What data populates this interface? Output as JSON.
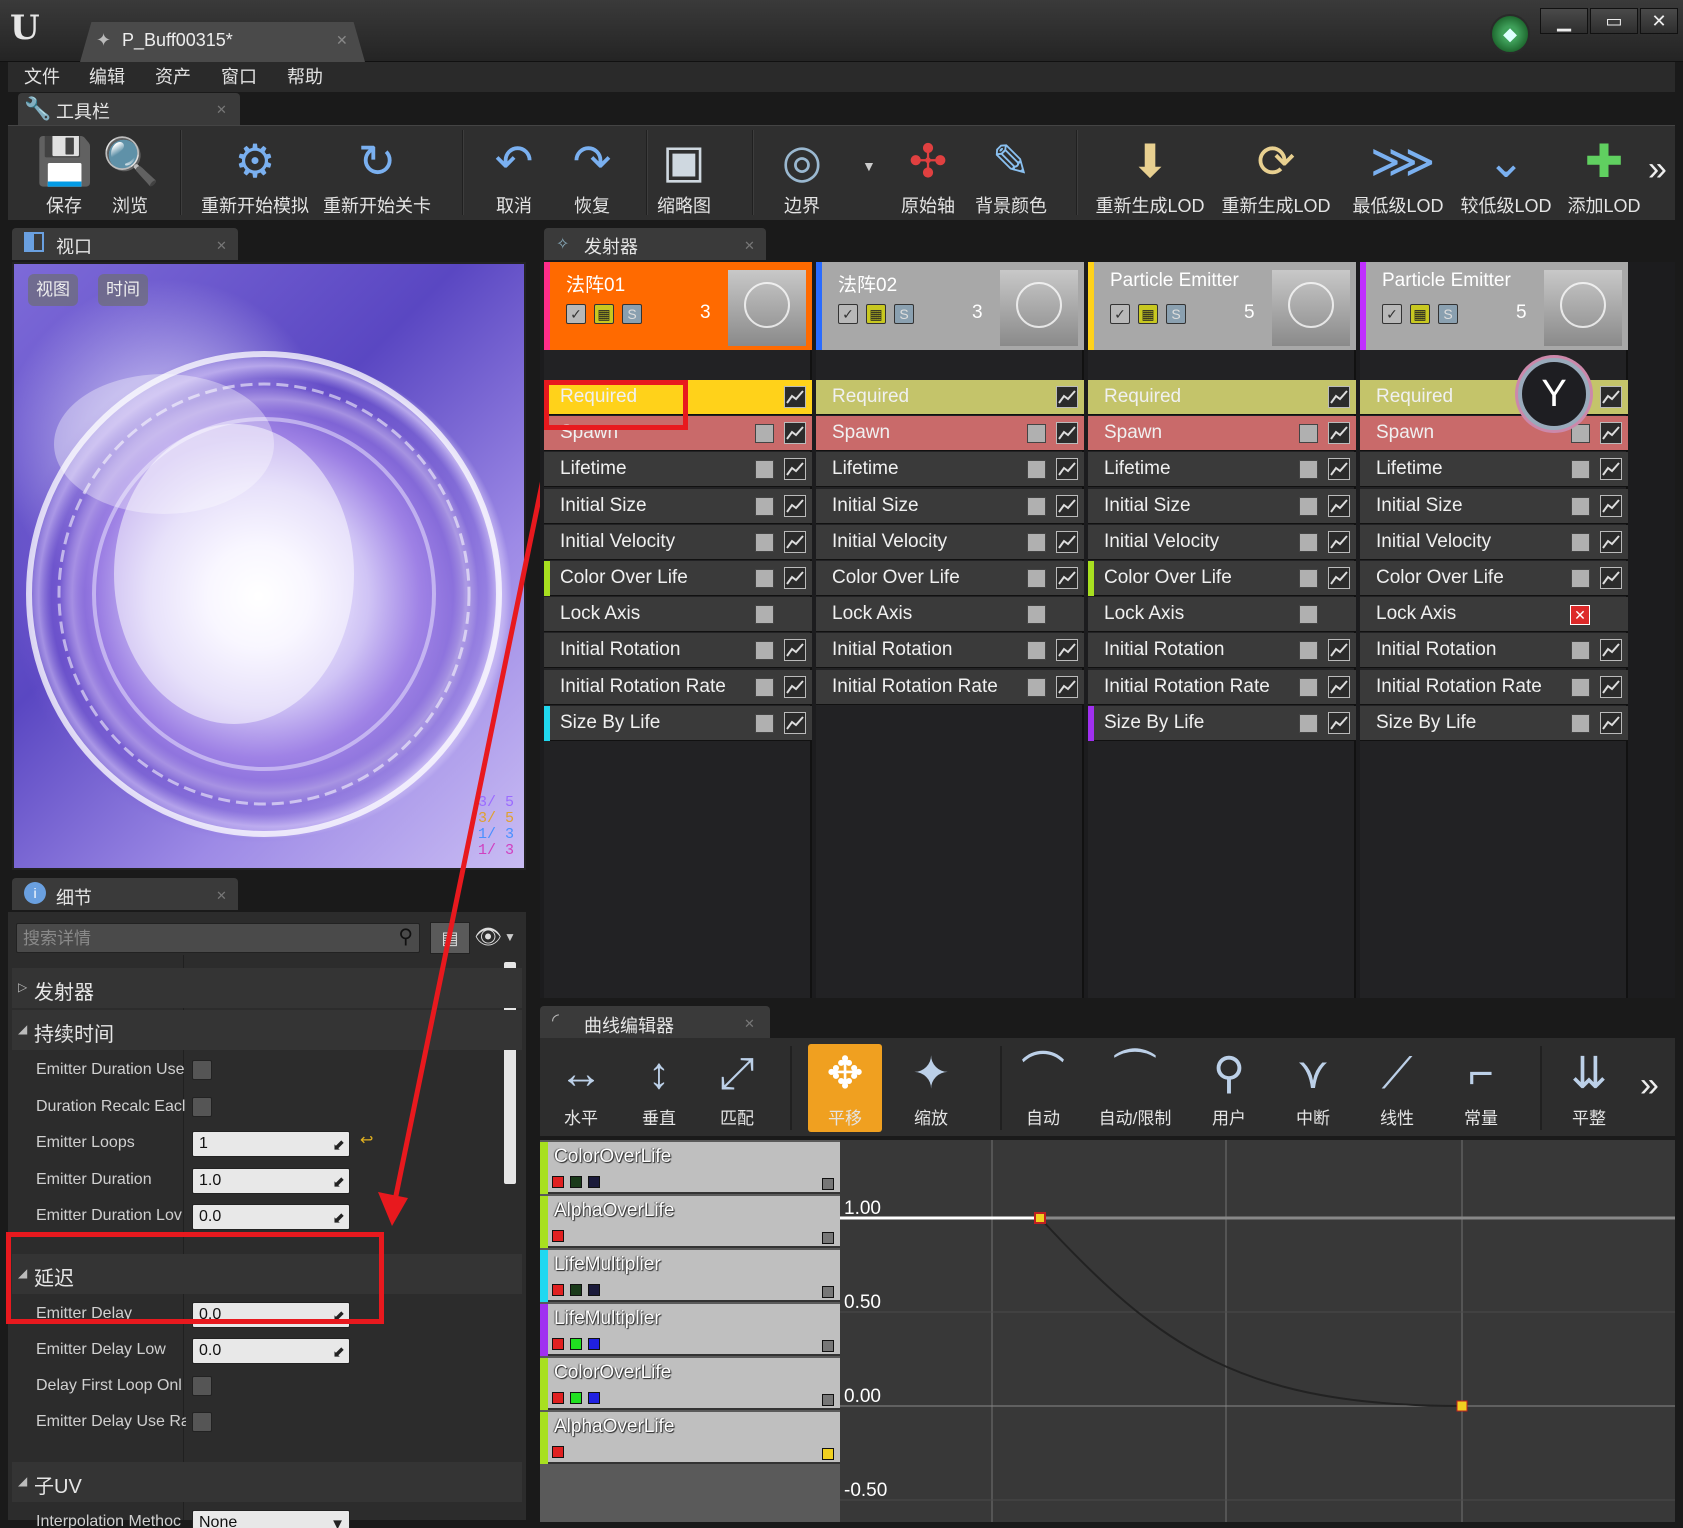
{
  "window": {
    "doc_tab": "P_Buff00315*",
    "minimize": "▁",
    "maximize": "▭",
    "close": "✕"
  },
  "menu": [
    "文件",
    "编辑",
    "资产",
    "窗口",
    "帮助"
  ],
  "toolbar": {
    "tab": "工具栏",
    "items": [
      {
        "label": "保存",
        "icon": "save-icon"
      },
      {
        "label": "浏览",
        "icon": "browse-icon"
      },
      {
        "label": "重新开始模拟",
        "icon": "restart-sim-icon"
      },
      {
        "label": "重新开始关卡",
        "icon": "restart-level-icon"
      },
      {
        "label": "取消",
        "icon": "undo-icon"
      },
      {
        "label": "恢复",
        "icon": "redo-icon"
      },
      {
        "label": "缩略图",
        "icon": "thumbnail-icon"
      },
      {
        "label": "边界",
        "icon": "bounds-icon"
      },
      {
        "label": "原始轴",
        "icon": "origin-axis-icon"
      },
      {
        "label": "背景颜色",
        "icon": "background-color-icon"
      },
      {
        "label": "重新生成LOD",
        "icon": "regen-lod-icon"
      },
      {
        "label": "重新生成LOD",
        "icon": "regen-lod-alt-icon"
      },
      {
        "label": "最低级LOD",
        "icon": "lowest-lod-icon"
      },
      {
        "label": "较低级LOD",
        "icon": "lower-lod-icon"
      },
      {
        "label": "添加LOD",
        "icon": "add-lod-icon"
      }
    ],
    "more": "»"
  },
  "viewport": {
    "tab": "视口",
    "view_btn": "视图",
    "time_btn": "时间",
    "stats": [
      {
        "text": "3/ 5",
        "color": "#9b6cff"
      },
      {
        "text": "3/ 5",
        "color": "#e0a030"
      },
      {
        "text": "1/ 3",
        "color": "#4a90ff"
      },
      {
        "text": "1/ 3",
        "color": "#d040c0"
      }
    ]
  },
  "details": {
    "tab": "细节",
    "search_placeholder": "搜索详情",
    "categories": {
      "emitter": "发射器",
      "duration": "持续时间",
      "delay": "延迟",
      "subuv": "子UV"
    },
    "duration_props": [
      {
        "name": "Emitter Duration Use",
        "type": "check"
      },
      {
        "name": "Duration Recalc Eacl",
        "type": "check"
      },
      {
        "name": "Emitter Loops",
        "type": "input",
        "value": "1"
      },
      {
        "name": "Emitter Duration",
        "type": "input",
        "value": "1.0"
      },
      {
        "name": "Emitter Duration Lov",
        "type": "input",
        "value": "0.0"
      }
    ],
    "delay_props": [
      {
        "name": "Emitter Delay",
        "type": "input",
        "value": "0.0"
      },
      {
        "name": "Emitter Delay Low",
        "type": "input",
        "value": "0.0"
      },
      {
        "name": "Delay First Loop Onl",
        "type": "check"
      },
      {
        "name": "Emitter Delay Use Ra",
        "type": "check"
      }
    ],
    "subuv_props": [
      {
        "name": "Interpolation Methoc",
        "type": "select",
        "value": "None"
      }
    ]
  },
  "emitters": {
    "tab": "发射器",
    "columns": [
      {
        "name": "法阵01",
        "count": "3",
        "head_color": "#ff6a00",
        "accent": "#ff2d8a",
        "modules": [
          "Required",
          "Spawn",
          "Lifetime",
          "Initial Size",
          "Initial Velocity",
          "Color Over Life",
          "Lock Axis",
          "Initial Rotation",
          "Initial Rotation Rate",
          "Size By Life"
        ]
      },
      {
        "name": "法阵02",
        "count": "3",
        "head_color": "#a8a8a8",
        "accent": "#2a6cff",
        "modules": [
          "Required",
          "Spawn",
          "Lifetime",
          "Initial Size",
          "Initial Velocity",
          "Color Over Life",
          "Lock Axis",
          "Initial Rotation",
          "Initial Rotation Rate"
        ]
      },
      {
        "name": "Particle Emitter",
        "count": "5",
        "head_color": "#a8a8a8",
        "accent": "#ffd21a",
        "modules": [
          "Required",
          "Spawn",
          "Lifetime",
          "Initial Size",
          "Initial Velocity",
          "Color Over Life",
          "Lock Axis",
          "Initial Rotation",
          "Initial Rotation Rate",
          "Size By Life"
        ]
      },
      {
        "name": "Particle Emitter",
        "count": "5",
        "head_color": "#a8a8a8",
        "accent": "#c030ff",
        "modules": [
          "Required",
          "Spawn",
          "Lifetime",
          "Initial Size",
          "Initial Velocity",
          "Color Over Life",
          "Lock Axis",
          "Initial Rotation",
          "Initial Rotation Rate",
          "Size By Life"
        ]
      }
    ]
  },
  "curve_editor": {
    "tab": "曲线编辑器",
    "tools": [
      {
        "label": "水平",
        "icon": "fit-horizontal-icon"
      },
      {
        "label": "垂直",
        "icon": "fit-vertical-icon"
      },
      {
        "label": "匹配",
        "icon": "fit-icon"
      },
      {
        "label": "平移",
        "icon": "pan-icon",
        "active": true
      },
      {
        "label": "缩放",
        "icon": "zoom-icon"
      },
      {
        "label": "自动",
        "icon": "auto-tangent-icon"
      },
      {
        "label": "自动/限制",
        "icon": "auto-clamped-icon"
      },
      {
        "label": "用户",
        "icon": "user-tangent-icon"
      },
      {
        "label": "中断",
        "icon": "break-tangent-icon"
      },
      {
        "label": "线性",
        "icon": "linear-icon"
      },
      {
        "label": "常量",
        "icon": "constant-icon"
      },
      {
        "label": "平整",
        "icon": "flatten-icon"
      }
    ],
    "more": "»",
    "curves": [
      {
        "name": "ColorOverLife",
        "bar": "#a8e020",
        "swatches": [
          "#e02020",
          "#1a3a1a",
          "#1a1a3a"
        ],
        "box": "#777777"
      },
      {
        "name": "AlphaOverLife",
        "bar": "#a8e020",
        "swatches": [
          "#e02020"
        ],
        "box": "#777777"
      },
      {
        "name": "LifeMultiplier",
        "bar": "#20d8f0",
        "swatches": [
          "#e02020",
          "#1a3a1a",
          "#1a1a3a"
        ],
        "box": "#777777"
      },
      {
        "name": "LifeMultiplier",
        "bar": "#a030f0",
        "swatches": [
          "#e02020",
          "#20e020",
          "#2020e0"
        ],
        "box": "#777777"
      },
      {
        "name": "ColorOverLife",
        "bar": "#a8e020",
        "swatches": [
          "#e02020",
          "#20e020",
          "#2020e0"
        ],
        "box": "#777777"
      },
      {
        "name": "AlphaOverLife",
        "bar": "#a8e020",
        "swatches": [
          "#e02020"
        ],
        "box": "#f0d020"
      }
    ],
    "ticks": [
      "1.00",
      "0.50",
      "0.00",
      "-0.50"
    ]
  }
}
